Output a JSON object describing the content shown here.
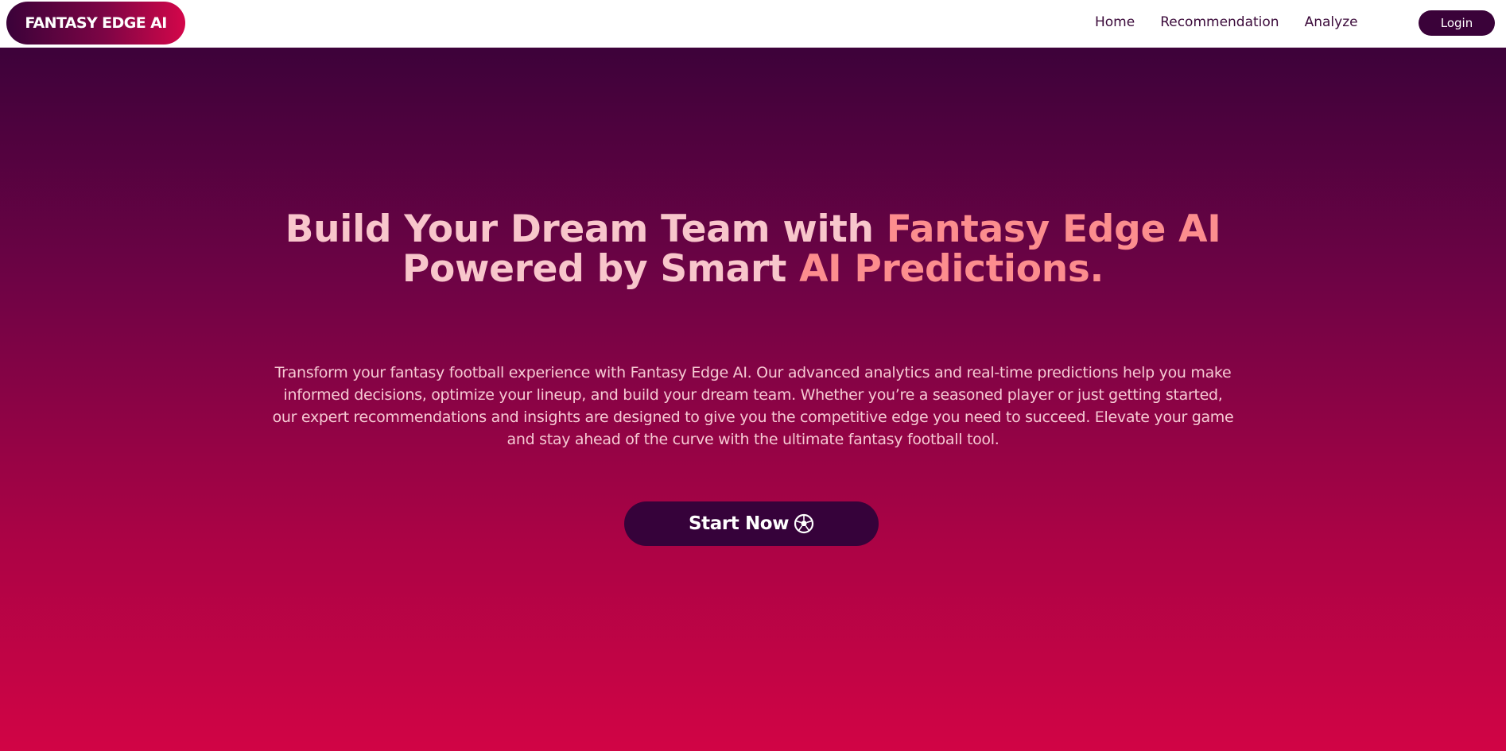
{
  "header": {
    "logo_text": "FANTASY EDGE AI",
    "nav": [
      {
        "label": "Home"
      },
      {
        "label": "Recommendation"
      },
      {
        "label": "Analyze"
      }
    ],
    "login_label": "Login"
  },
  "hero": {
    "headline_line1_part1": "Build Your Dream Team with ",
    "headline_line1_part2": "Fantasy Edge AI",
    "headline_line2_part1": "Powered by Smart ",
    "headline_line2_part2": "AI Predictions.",
    "description": "Transform your fantasy football experience with Fantasy Edge AI. Our advanced analytics and real-time predictions help you make informed decisions, optimize your lineup, and build your dream team. Whether you’re a seasoned player or just getting started, our expert recommendations and insights are designed to give you the competitive edge you need to succeed. Elevate your game and stay ahead of the curve with the ultimate fantasy football tool.",
    "cta_label": "Start Now",
    "cta_icon": "soccer-ball-icon"
  },
  "colors": {
    "brand_dark": "#3a0239",
    "brand_red": "#d4064a",
    "headline_light": "#f8c6cb",
    "headline_accent": "#fc8d8e"
  }
}
